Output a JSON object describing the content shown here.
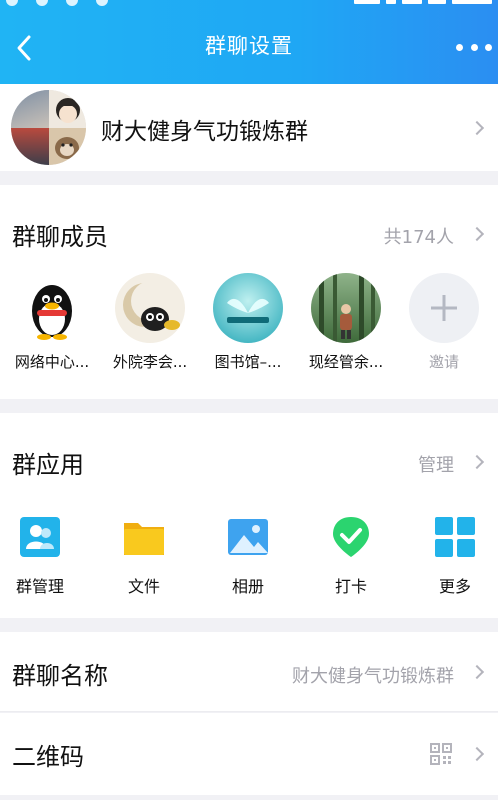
{
  "header": {
    "title": "群聊设置",
    "background": "#1fa7f4"
  },
  "group": {
    "name": "财大健身气功锻炼群"
  },
  "members": {
    "title": "群聊成员",
    "count_label": "共174人",
    "items": [
      {
        "label": "网络中心...",
        "avatar": "penguin-avatar"
      },
      {
        "label": "外院李会...",
        "avatar": "cat-moon-avatar"
      },
      {
        "label": "图书馆–...",
        "avatar": "book-avatar"
      },
      {
        "label": "现经管余...",
        "avatar": "forest-avatar"
      }
    ],
    "invite_label": "邀请"
  },
  "apps": {
    "title": "群应用",
    "manage_label": "管理",
    "items": [
      {
        "label": "群管理",
        "icon": "group-manage-icon",
        "color": "#22b3ea"
      },
      {
        "label": "文件",
        "icon": "folder-icon",
        "color": "#f7c21a"
      },
      {
        "label": "相册",
        "icon": "photo-album-icon",
        "color": "#3ea3ef"
      },
      {
        "label": "打卡",
        "icon": "check-in-icon",
        "color": "#2bd46f"
      },
      {
        "label": "更多",
        "icon": "grid-more-icon",
        "color": "#22b3ea"
      }
    ]
  },
  "group_name_row": {
    "title": "群聊名称",
    "value": "财大健身气功锻炼群"
  },
  "qr_row": {
    "title": "二维码"
  }
}
